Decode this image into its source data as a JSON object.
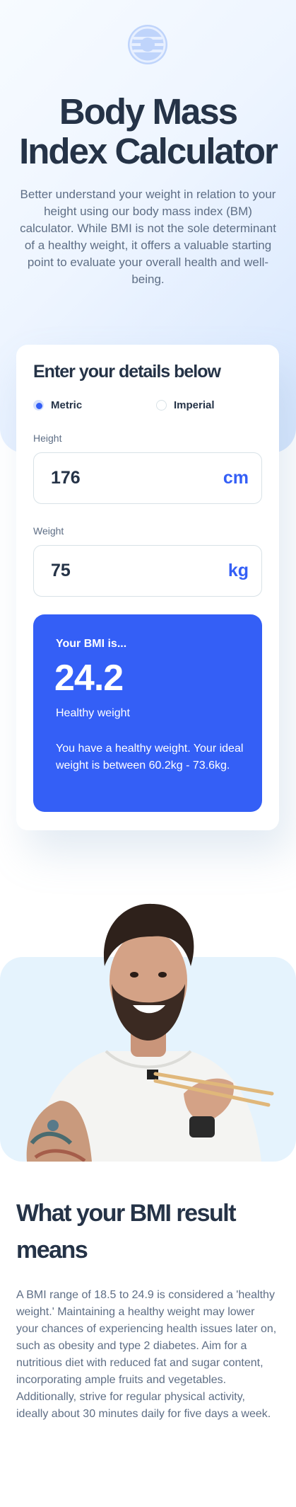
{
  "hero": {
    "title": "Body Mass Index Calculator",
    "description": "Better understand your weight in relation to your height using our body mass index (BM) calculator. While BMI is not the sole determinant of a healthy weight, it offers a valuable starting point to evaluate your overall health and well-being."
  },
  "form": {
    "title": "Enter your details below",
    "units": [
      {
        "label": "Metric",
        "checked": true
      },
      {
        "label": "Imperial",
        "checked": false
      }
    ],
    "height": {
      "label": "Height",
      "value": "176",
      "unit": "cm"
    },
    "weight": {
      "label": "Weight",
      "value": "75",
      "unit": "kg"
    }
  },
  "result": {
    "heading": "Your BMI is...",
    "value": "24.2",
    "classification": "Healthy weight",
    "description": "You have a healthy weight. Your ideal weight is between 60.2kg - 73.6kg."
  },
  "meaning": {
    "title": "What your BMI result means",
    "body": "A BMI range of 18.5 to 24.9 is considered a 'healthy weight.' Maintaining a healthy weight may lower your chances of experiencing health issues later on, such as obesity and type 2 diabetes. Aim for a nutritious diet with reduced fat and sugar content, incorporating ample fruits and vegetables. Additionally, strive for regular physical activity, ideally about 30 minutes daily for five days a week."
  },
  "colors": {
    "accent": "#345ff6",
    "text_dark": "#253347",
    "text_muted": "#5e6e85",
    "photo_bg": "#e5f3fd"
  },
  "icons": {
    "logo": "bmi-logo-icon",
    "photo": "man-eating-with-chopsticks-image"
  }
}
